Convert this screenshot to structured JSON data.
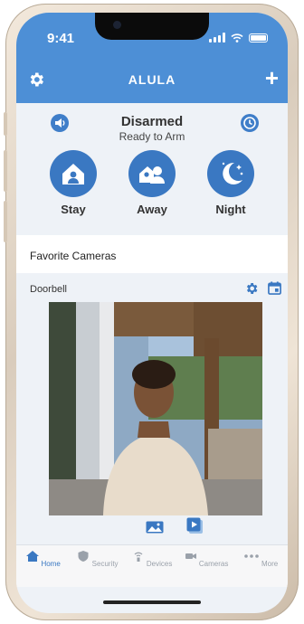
{
  "status_bar": {
    "time": "9:41"
  },
  "app": {
    "title": "ALULA",
    "accent": "#4d8fd6"
  },
  "arm": {
    "state": "Disarmed",
    "sub": "Ready to Arm",
    "modes": [
      {
        "label": "Stay",
        "icon": "house-person-icon"
      },
      {
        "label": "Away",
        "icon": "people-house-icon"
      },
      {
        "label": "Night",
        "icon": "moon-stars-icon"
      }
    ]
  },
  "favorites": {
    "header": "Favorite Cameras"
  },
  "camera": {
    "name": "Doorbell"
  },
  "tabs": [
    {
      "label": "Home",
      "icon": "home-icon"
    },
    {
      "label": "Security",
      "icon": "shield-icon"
    },
    {
      "label": "Devices",
      "icon": "devices-icon"
    },
    {
      "label": "Cameras",
      "icon": "camera-icon"
    },
    {
      "label": "More",
      "icon": "more-icon"
    }
  ]
}
